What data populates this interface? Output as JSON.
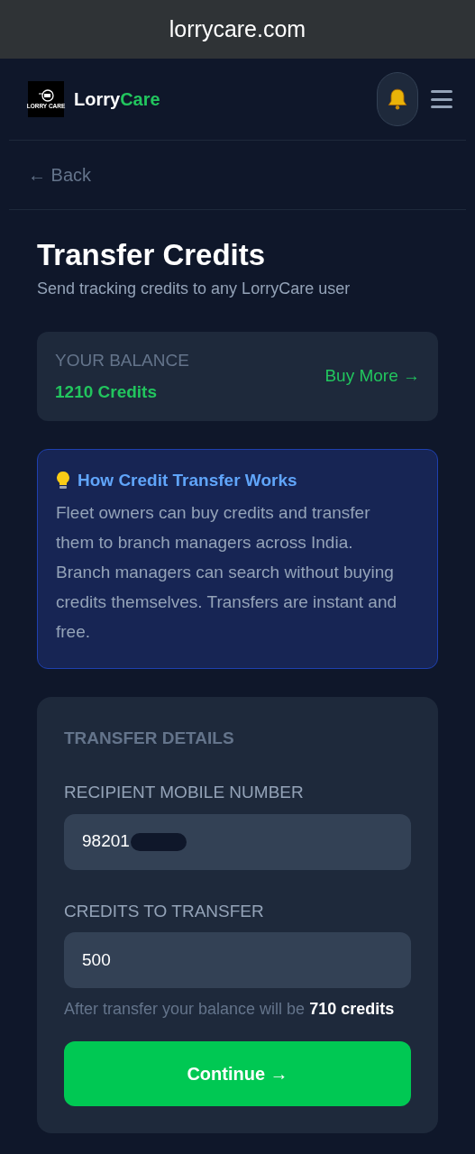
{
  "browser": {
    "url": "lorrycare.com"
  },
  "header": {
    "logo_text": "LORRY CARE",
    "brand_first": "Lorry",
    "brand_second": "Care"
  },
  "back_link": "← Back",
  "page": {
    "title": "Transfer Credits",
    "subtitle": "Send tracking credits to any LorryCare user"
  },
  "balance": {
    "label": "YOUR BALANCE",
    "value": "1210 Credits",
    "action": "Buy More →"
  },
  "info": {
    "title": "How Credit Transfer Works",
    "text": "Fleet owners can buy credits and transfer them to branch managers across India. Branch managers can search without buying credits themselves. Transfers are instant and free."
  },
  "form": {
    "heading": "TRANSFER DETAILS",
    "fields": [
      {
        "label": "RECIPIENT MOBILE NUMBER",
        "value": "98201",
        "redacted": true
      },
      {
        "label": "CREDITS TO TRANSFER",
        "value": "500",
        "redacted": false
      }
    ],
    "note": "After transfer your balance will be **710 credits**",
    "submit": "Continue →"
  }
}
